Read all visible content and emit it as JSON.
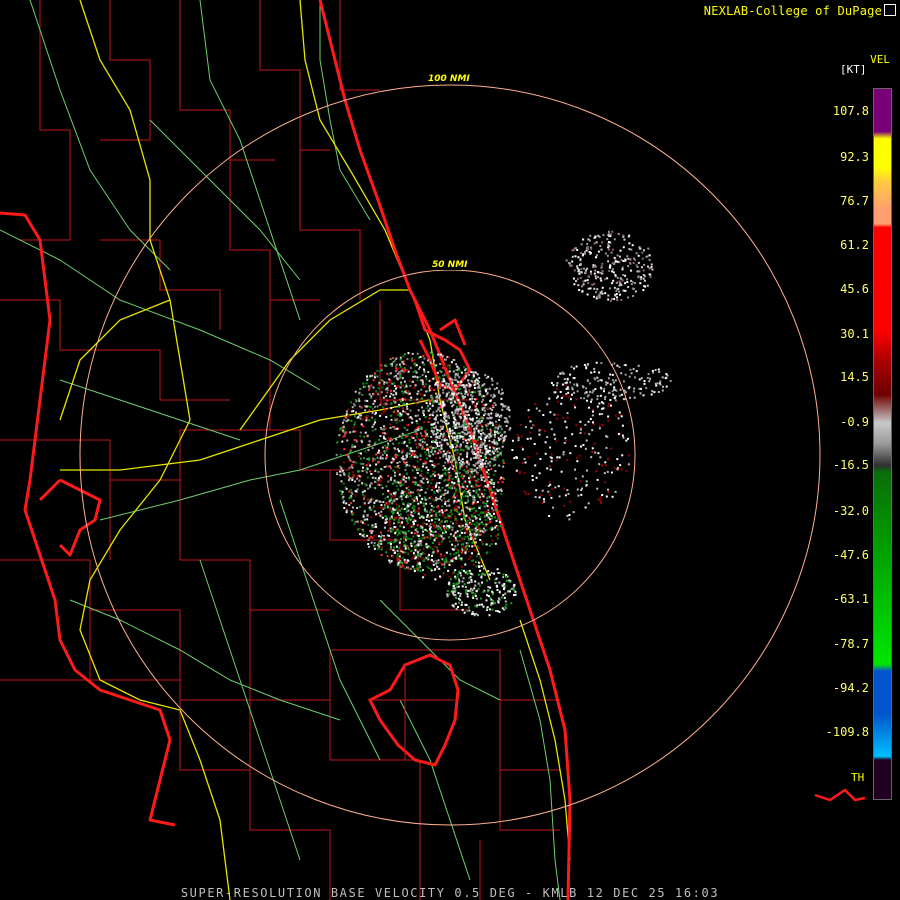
{
  "credit": "NEXLAB-College of DuPage",
  "product_label": "SUPER-RESOLUTION BASE VELOCITY 0.5 DEG - KMLB 12 DEC 25 16:03",
  "legend": {
    "product": "VEL",
    "unit": "[KT]",
    "ticks": [
      "107.8",
      "92.3",
      "76.7",
      "61.2",
      "45.6",
      "30.1",
      "14.5",
      "-0.9",
      "-16.5",
      "-32.0",
      "-47.6",
      "-63.1",
      "-78.7",
      "-94.2",
      "-109.8"
    ],
    "th_label": "TH",
    "colors": {
      "purple": "#7a0078",
      "yellow": "#ffff00",
      "peach": "#ff9e6e",
      "red": "#ff0000",
      "darkred": "#6e0000",
      "gray": "#9a9a9a",
      "darkgreen": "#0a6e0a",
      "green": "#00e600",
      "blue": "#0055cc",
      "cyan": "#00bfff"
    }
  },
  "range_rings": [
    {
      "label": "100 NMI"
    },
    {
      "label": "50 NMI"
    }
  ],
  "map_colors": {
    "coast": "#ff1a1a",
    "county": "#d02020",
    "highway": "#e6e600",
    "road": "#6ecf6e",
    "ring": "#ffb090"
  }
}
